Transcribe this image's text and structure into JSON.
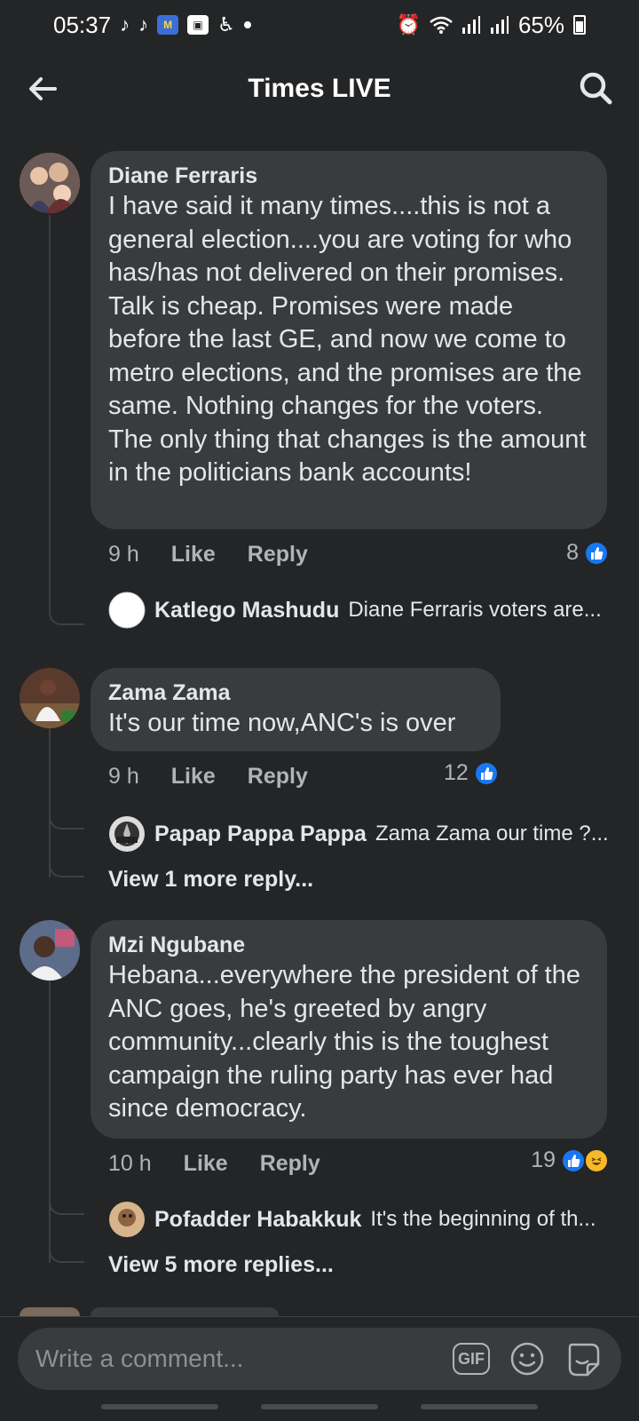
{
  "status_bar": {
    "time": "05:37",
    "battery": "65%",
    "notif_icons": [
      "tiktok-icon",
      "tiktok-icon",
      "mvn-app-icon",
      "gallery-app-icon",
      "accessibility-icon",
      "dot-icon"
    ],
    "sys_icons": [
      "alarm-icon",
      "wifi-icon",
      "signal-icon",
      "signal-icon",
      "battery-icon"
    ]
  },
  "header": {
    "title": "Times LIVE"
  },
  "comments": [
    {
      "author": "Diane Ferraris",
      "text": "I have said it many times....this is not a general election....you are voting for who has/has not delivered on their promises. Talk is cheap.  Promises were made before the last GE, and now we come to metro elections, and the promises are the same.  Nothing changes for the voters.  The only thing that changes is the amount in the politicians bank accounts!",
      "time": "9 h",
      "like_label": "Like",
      "reply_label": "Reply",
      "reaction_count": "8",
      "replies": [
        {
          "author": "Katlego Mashudu",
          "text": "Diane Ferraris  voters are..."
        }
      ]
    },
    {
      "author": "Zama Zama",
      "text": "It's our time now,ANC's is over",
      "time": "9 h",
      "like_label": "Like",
      "reply_label": "Reply",
      "reaction_count": "12",
      "replies": [
        {
          "author": "Papap Pappa Pappa",
          "text": "Zama Zama our time ?..."
        }
      ],
      "view_more": "View 1 more reply..."
    },
    {
      "author": "Mzi Ngubane",
      "text": "Hebana...everywhere the president of the ANC goes, he's greeted by angry community...clearly this is the toughest campaign the ruling party has ever had since democracy.",
      "time": "10 h",
      "like_label": "Like",
      "reply_label": "Reply",
      "reaction_count": "19",
      "replies": [
        {
          "author": "Pofadder Habakkuk",
          "text": "It's the beginning of th..."
        }
      ],
      "view_more": "View 5 more replies..."
    }
  ],
  "composer": {
    "placeholder": "Write a comment...",
    "gif_label": "GIF"
  },
  "colors": {
    "background": "#242526",
    "bubble": "#3a3b3c",
    "like_blue": "#1877f2",
    "muted_text": "#b0b3b8"
  }
}
